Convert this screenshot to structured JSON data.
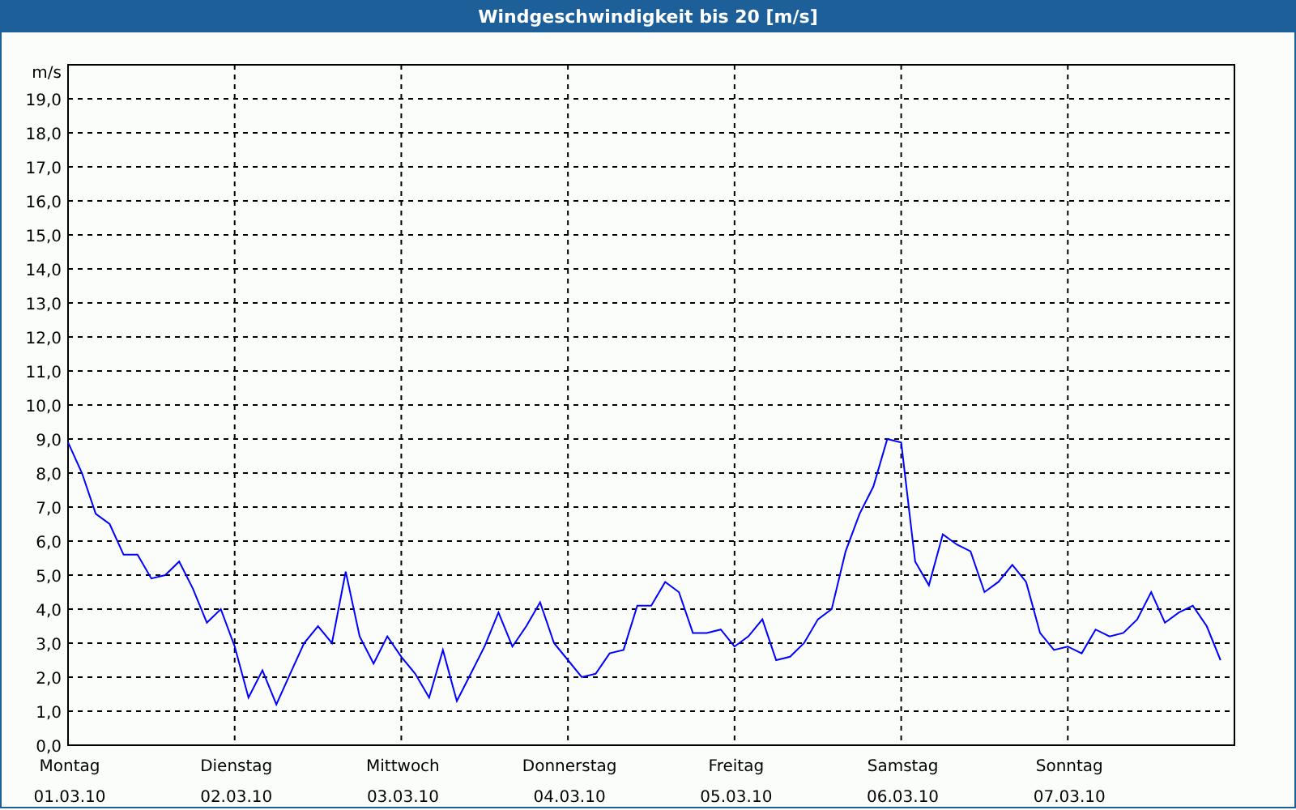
{
  "chart_data": {
    "type": "line",
    "title": "Windgeschwindigkeit bis 20 [m/s]",
    "ylabel": "m/s",
    "ylim": [
      0,
      20
    ],
    "grid": true,
    "categories": [
      "Montag\n01.03.10",
      null,
      null,
      null,
      null,
      null,
      null,
      null,
      null,
      null,
      null,
      null,
      "Dienstag\n02.03.10",
      null,
      null,
      null,
      null,
      null,
      null,
      null,
      null,
      null,
      null,
      null,
      "Mittwoch\n03.03.10",
      null,
      null,
      null,
      null,
      null,
      null,
      null,
      null,
      null,
      null,
      null,
      "Donnerstag\n04.03.10",
      null,
      null,
      null,
      null,
      null,
      null,
      null,
      null,
      null,
      null,
      null,
      "Freitag\n05.03.10",
      null,
      null,
      null,
      null,
      null,
      null,
      null,
      null,
      null,
      null,
      null,
      "Samstag\n06.03.10",
      null,
      null,
      null,
      null,
      null,
      null,
      null,
      null,
      null,
      null,
      null,
      "Sonntag\n07.03.10",
      null,
      null,
      null,
      null,
      null,
      null,
      null,
      null,
      null,
      null,
      null
    ],
    "yticks": [
      {
        "value": 0,
        "label": "0,0"
      },
      {
        "value": 1,
        "label": "1,0"
      },
      {
        "value": 2,
        "label": "2,0"
      },
      {
        "value": 3,
        "label": "3,0"
      },
      {
        "value": 4,
        "label": "4,0"
      },
      {
        "value": 5,
        "label": "5,0"
      },
      {
        "value": 6,
        "label": "6,0"
      },
      {
        "value": 7,
        "label": "7,0"
      },
      {
        "value": 8,
        "label": "8,0"
      },
      {
        "value": 9,
        "label": "9,0"
      },
      {
        "value": 10,
        "label": "10,0"
      },
      {
        "value": 11,
        "label": "11,0"
      },
      {
        "value": 12,
        "label": "12,0"
      },
      {
        "value": 13,
        "label": "13,0"
      },
      {
        "value": 14,
        "label": "14,0"
      },
      {
        "value": 15,
        "label": "15,0"
      },
      {
        "value": 16,
        "label": "16,0"
      },
      {
        "value": 17,
        "label": "17,0"
      },
      {
        "value": 18,
        "label": "18,0"
      },
      {
        "value": 19,
        "label": "19,0"
      }
    ],
    "series": [
      {
        "color": "#0000ff",
        "values": [
          8.9,
          8.0,
          6.8,
          6.5,
          5.6,
          5.6,
          4.9,
          5.0,
          5.4,
          4.6,
          3.6,
          4.0,
          2.9,
          1.4,
          2.2,
          1.2,
          2.1,
          3.0,
          3.5,
          3.0,
          5.1,
          3.2,
          2.4,
          3.2,
          2.6,
          2.1,
          1.4,
          2.8,
          1.3,
          2.1,
          2.9,
          3.9,
          2.9,
          3.5,
          4.2,
          3.0,
          2.5,
          2.0,
          2.1,
          2.7,
          2.8,
          4.1,
          4.1,
          4.8,
          4.5,
          3.3,
          3.3,
          3.4,
          2.9,
          3.2,
          3.7,
          2.5,
          2.6,
          3.0,
          3.7,
          4.0,
          5.7,
          6.8,
          7.6,
          9.0,
          8.9,
          5.4,
          4.7,
          6.2,
          5.9,
          5.7,
          4.5,
          4.8,
          5.3,
          4.8,
          3.3,
          2.8,
          2.9,
          2.7,
          3.4,
          3.2,
          3.3,
          3.7,
          4.5,
          3.6,
          3.9,
          4.1,
          3.5,
          2.5
        ]
      }
    ]
  }
}
